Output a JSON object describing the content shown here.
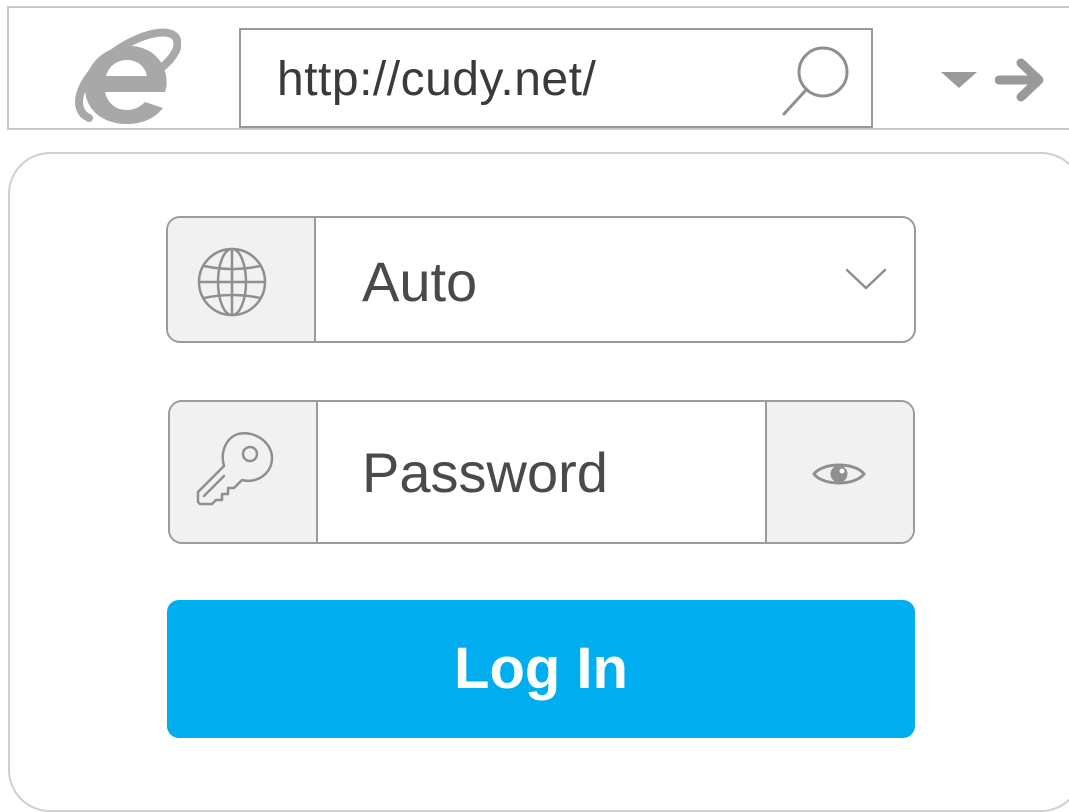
{
  "browser": {
    "address": "http://cudy.net/",
    "icons": {
      "logo": "internet-explorer-logo",
      "search": "search-icon",
      "dropdown": "dropdown-arrow-icon",
      "forward": "forward-arrow-icon"
    }
  },
  "login": {
    "language": {
      "value": "Auto",
      "icon": "globe-icon"
    },
    "password": {
      "placeholder": "Password",
      "value": "",
      "icon": "key-icon",
      "toggle_icon": "eye-icon"
    },
    "submit_label": "Log In"
  },
  "colors": {
    "accent": "#00aeef",
    "border": "#9b9b9b",
    "icon_cell_bg": "#f1f1f2",
    "text": "#4a4a4a",
    "icon_gray": "#8f8f8f"
  }
}
